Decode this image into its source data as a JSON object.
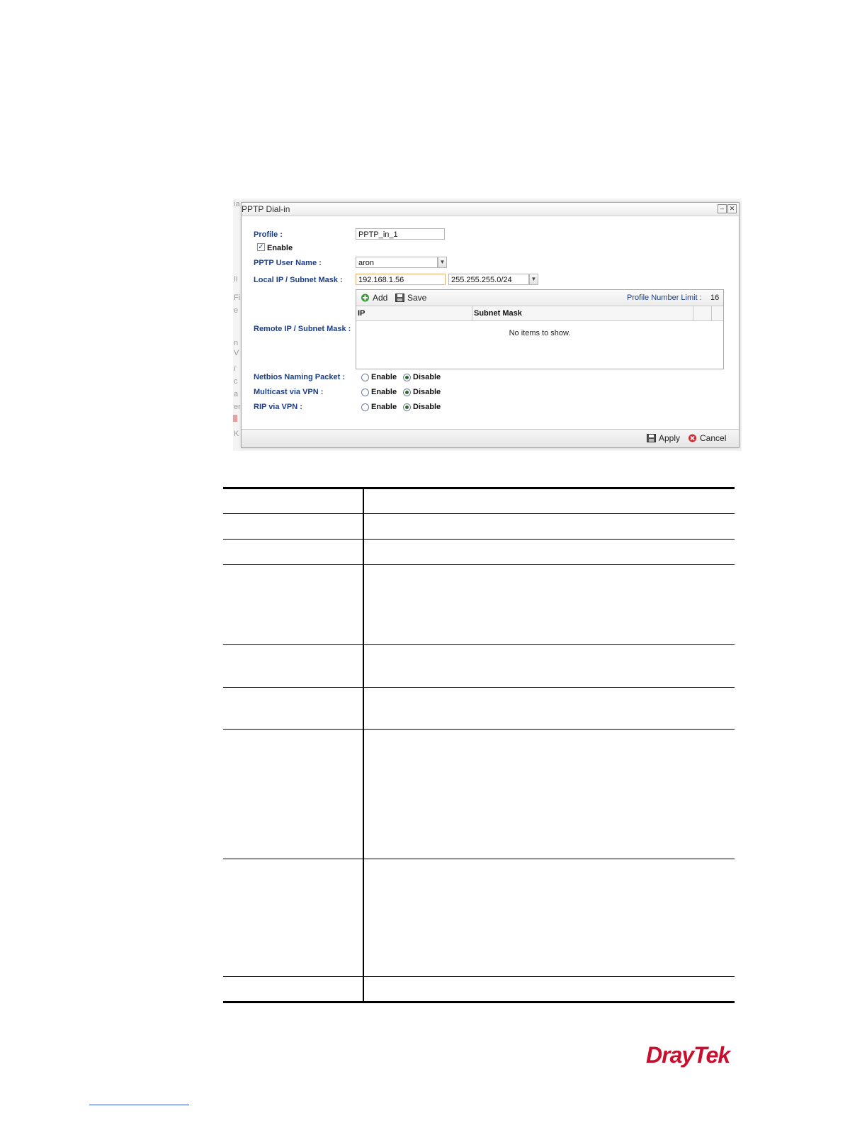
{
  "dialog": {
    "title": "PPTP Dial-in",
    "minimize_glyph": "–",
    "close_glyph": "✕",
    "profile_label": "Profile :",
    "profile_value": "PPTP_in_1",
    "enable_label": "Enable",
    "enable_checked": true,
    "username_label": "PPTP User Name :",
    "username_value": "aron",
    "local_ip_label": "Local IP / Subnet Mask :",
    "local_ip_value": "192.168.1.56",
    "local_mask_value": "255.255.255.0/24",
    "remote_ip_label": "Remote IP / Subnet Mask :",
    "grid": {
      "add_label": "Add",
      "save_label": "Save",
      "limit_label": "Profile Number Limit :",
      "limit_value": "16",
      "columns": [
        "IP",
        "Subnet Mask"
      ],
      "empty_text": "No items to show."
    },
    "radio_groups": [
      {
        "label": "Netbios Naming Packet :",
        "enable": "Enable",
        "disable": "Disable",
        "selected": "Disable"
      },
      {
        "label": "Multicast via VPN :",
        "enable": "Enable",
        "disable": "Disable",
        "selected": "Disable"
      },
      {
        "label": "RIP via VPN :",
        "enable": "Enable",
        "disable": "Disable",
        "selected": "Disable"
      }
    ],
    "apply_label": "Apply",
    "cancel_label": "Cancel"
  },
  "background_fragments": [
    "ia",
    "Ii",
    "e",
    "Fi",
    "e",
    "n",
    "V",
    "r",
    "c",
    "a",
    "er",
    "K"
  ],
  "logo": "DrayTek",
  "colors": {
    "label_blue": "#1c3f8a",
    "brand_red": "#c8102e",
    "cancel_red": "#d9262e",
    "add_green": "#3a9a3a"
  }
}
